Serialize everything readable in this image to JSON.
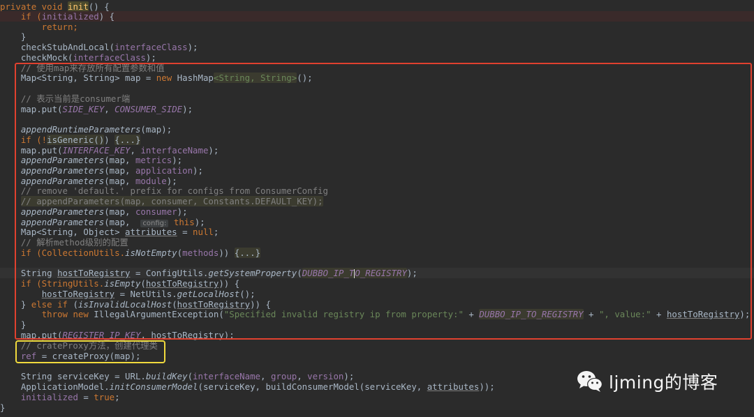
{
  "code": {
    "l1_a": "private void ",
    "l1_b": "init",
    "l1_c": "() {",
    "l2_a": "    if (",
    "l2_b": "initialized",
    "l2_c": ") {",
    "l3": "        return;",
    "l4": "    }",
    "l5_a": "    checkStubAndLocal(",
    "l5_b": "interfaceClass",
    "l5_c": ");",
    "l6_a": "    checkMock(",
    "l6_b": "interfaceClass",
    "l6_c": ");",
    "l7": "    // 使用map来存放所有配置参数和值",
    "l8_a": "    Map<String, String> map = ",
    "l8_b": "new",
    "l8_c": " HashMap",
    "l8_d": "<String, String>",
    "l8_e": "();",
    "l9": "    // 表示当前是consumer端",
    "l10_a": "    map.put(",
    "l10_b": "SIDE_KEY",
    "l10_c": ", ",
    "l10_d": "CONSUMER_SIDE",
    "l10_e": ");",
    "l11_a": "    ",
    "l11_b": "appendRuntimeParameters",
    "l11_c": "(map);",
    "l12_a": "    if (!",
    "l12_b": "isGeneric()",
    "l12_c": ") ",
    "l12_d": "{...}",
    "l13_a": "    map.put(",
    "l13_b": "INTERFACE_KEY",
    "l13_c": ", ",
    "l13_d": "interfaceName",
    "l13_e": ");",
    "l14_a": "    ",
    "l14_b": "appendParameters",
    "l14_c": "(map, ",
    "l14_d": "metrics",
    "l14_e": ");",
    "l15_a": "    ",
    "l15_b": "appendParameters",
    "l15_c": "(map, ",
    "l15_d": "application",
    "l15_e": ");",
    "l16_a": "    ",
    "l16_b": "appendParameters",
    "l16_c": "(map, ",
    "l16_d": "module",
    "l16_e": ");",
    "l17": "    // remove 'default.' prefix for configs from ConsumerConfig",
    "l18_a": "    ",
    "l18_b": "// appendParameters(map, consumer, Constants.DEFAULT_KEY);",
    "l19_a": "    ",
    "l19_b": "appendParameters",
    "l19_c": "(map, ",
    "l19_d": "consumer",
    "l19_e": ");",
    "l20_a": "    ",
    "l20_b": "appendParameters",
    "l20_c": "(map,  ",
    "l20_hint": "config:",
    "l20_d": " this",
    "l20_e": ");",
    "l21_a": "    Map<String, Object> ",
    "l21_b": "attributes",
    "l21_c": " = ",
    "l21_d": "null",
    "l21_e": ";",
    "l22": "    // 解析method级别的配置",
    "l23_a": "    if (CollectionUtils.",
    "l23_b": "isNotEmpty",
    "l23_c": "(",
    "l23_d": "methods",
    "l23_e": ")) ",
    "l23_f": "{...}",
    "l24_a": "    String ",
    "l24_b": "hostToRegistry",
    "l24_c": " = ConfigUtils.",
    "l24_d": "getSystemProperty",
    "l24_e": "(",
    "l24_f": "DUBBO_IP_T",
    "l24_g": "O_REGISTRY",
    "l24_h": ");",
    "l25_a": "    if (StringUtils.",
    "l25_b": "isEmpty",
    "l25_c": "(",
    "l25_d": "hostToRegistry",
    "l25_e": ")) {",
    "l26_a": "        ",
    "l26_b": "hostToRegistry",
    "l26_c": " = NetUtils.",
    "l26_d": "getLocalHost",
    "l26_e": "();",
    "l27_a": "    } ",
    "l27_b": "else if",
    "l27_c": " (",
    "l27_d": "isInvalidLocalHost",
    "l27_e": "(",
    "l27_f": "hostToRegistry",
    "l27_g": ")) {",
    "l28_a": "        ",
    "l28_b": "throw new",
    "l28_c": " IllegalArgumentException(",
    "l28_d": "\"Specified invalid registry ip from property:\"",
    "l28_e": " + ",
    "l28_f": "DUBBO_IP_TO_REGISTRY",
    "l28_g": " + ",
    "l28_h": "\", value:\"",
    "l28_i": " + ",
    "l28_j": "hostToRegistry",
    "l28_k": ");",
    "l29": "    }",
    "l30_a": "    map.put(",
    "l30_b": "REGISTER_IP_KEY",
    "l30_c": ", hostToRegistry);",
    "l31": "    // crateProxy方法，创建代理类",
    "l32_a": "    ",
    "l32_b": "ref",
    "l32_c": " = createProxy(map);",
    "l33_a": "    String serviceKey = URL.",
    "l33_b": "buildKey",
    "l33_c": "(",
    "l33_d": "interfaceName",
    "l33_e": ", ",
    "l33_f": "group",
    "l33_g": ", ",
    "l33_h": "version",
    "l33_i": ");",
    "l34_a": "    ApplicationModel.",
    "l34_b": "initConsumerModel",
    "l34_c": "(serviceKey, buildConsumerModel(serviceKey, ",
    "l34_d": "attributes",
    "l34_e": "));",
    "l35_a": "    ",
    "l35_b": "initialized",
    "l35_c": " = ",
    "l35_d": "true",
    "l35_e": ";",
    "l36": "}"
  },
  "watermark": {
    "icon": "wechat-icon",
    "text": "ljming的博客"
  },
  "colors": {
    "background": "#2b2b2b",
    "red_box": "#e0412f",
    "yellow_box": "#f1da3d",
    "keyword": "#cc7832",
    "comment": "#808080",
    "string": "#6a8759",
    "field": "#9876aa",
    "method": "#ffc66d"
  }
}
